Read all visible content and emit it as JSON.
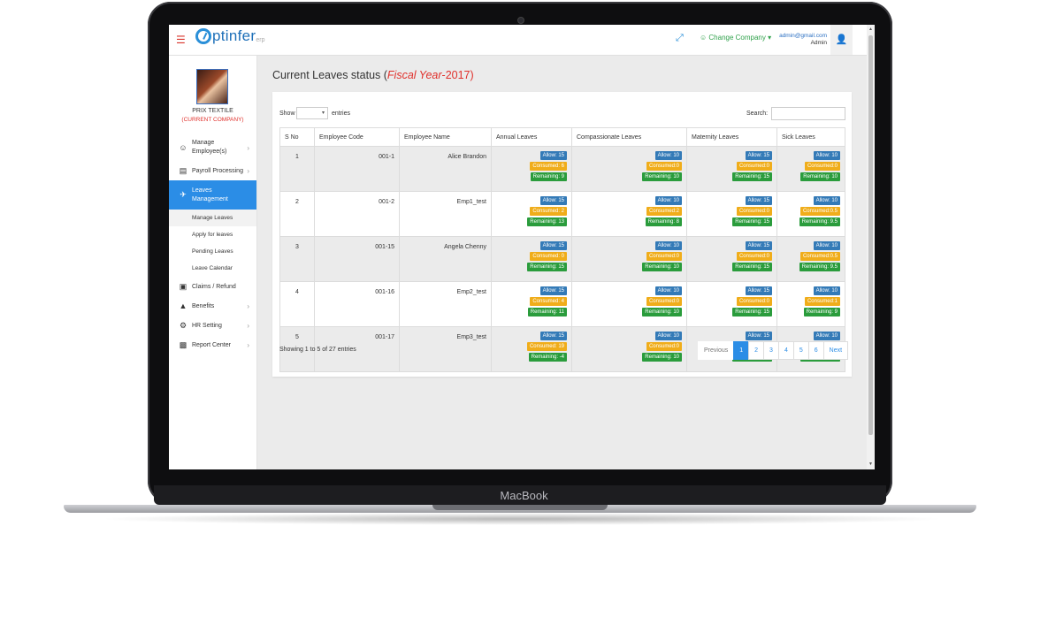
{
  "device": {
    "brand": "MacBook"
  },
  "topbar": {
    "logo_text": "ptinfer",
    "logo_sub": "erp",
    "change_company": "☺ Change Company ▾",
    "user_email": "admin@gmail.com",
    "user_role": "Admin"
  },
  "sidebar": {
    "company_name": "PRIX TEXTILE",
    "company_status": "(CURRENT COMPANY)",
    "items": [
      {
        "label": "Manage Employee(s)",
        "icon": "user-icon"
      },
      {
        "label": "Payroll Processing",
        "icon": "payroll-icon"
      },
      {
        "label": "Leaves Management",
        "icon": "plane-icon"
      },
      {
        "label": "Claims / Refund",
        "icon": "money-icon"
      },
      {
        "label": "Benefits",
        "icon": "gift-icon"
      },
      {
        "label": "HR Setting",
        "icon": "gear-icon"
      },
      {
        "label": "Report Center",
        "icon": "bar-chart-icon"
      }
    ],
    "leave_subitems": [
      "Manage Leaves",
      "Apply for leaves",
      "Pending Leaves",
      "Leave Calendar"
    ]
  },
  "page": {
    "title_prefix": "Current Leaves status (",
    "title_fiscal": "Fiscal Year",
    "title_year": "-2017)"
  },
  "table_controls": {
    "show_label": "Show",
    "entries_label": "entries",
    "search_label": "Search:"
  },
  "table": {
    "headers": [
      "S No",
      "Employee Code",
      "Employee Name",
      "Annual Leaves",
      "Compassionate Leaves",
      "Maternity Leaves",
      "Sick Leaves"
    ],
    "rows": [
      {
        "sno": "1",
        "code": "001-1",
        "name": "Alice Brandon",
        "annual": [
          "Allow: 15",
          "Consumed: 6",
          "Remaining: 9"
        ],
        "compassionate": [
          "Allow: 10",
          "Consumed:0",
          "Remaining: 10"
        ],
        "maternity": [
          "Allow: 15",
          "Consumed:0",
          "Remaining: 15"
        ],
        "sick": [
          "Allow: 10",
          "Consumed:0",
          "Remaining: 10"
        ]
      },
      {
        "sno": "2",
        "code": "001-2",
        "name": "Emp1_test",
        "annual": [
          "Allow: 15",
          "Consumed: 2",
          "Remaining: 13"
        ],
        "compassionate": [
          "Allow: 10",
          "Consumed:2",
          "Remaining: 8"
        ],
        "maternity": [
          "Allow: 15",
          "Consumed:0",
          "Remaining: 15"
        ],
        "sick": [
          "Allow: 10",
          "Consumed:0.5",
          "Remaining: 9.5"
        ]
      },
      {
        "sno": "3",
        "code": "001-15",
        "name": "Angela Chenny",
        "annual": [
          "Allow: 15",
          "Consumed: 0",
          "Remaining: 15"
        ],
        "compassionate": [
          "Allow: 10",
          "Consumed:0",
          "Remaining: 10"
        ],
        "maternity": [
          "Allow: 15",
          "Consumed:0",
          "Remaining: 15"
        ],
        "sick": [
          "Allow: 10",
          "Consumed:0.5",
          "Remaining: 9.5"
        ]
      },
      {
        "sno": "4",
        "code": "001-16",
        "name": "Emp2_test",
        "annual": [
          "Allow: 15",
          "Consumed: 4",
          "Remaining: 11"
        ],
        "compassionate": [
          "Allow: 10",
          "Consumed:0",
          "Remaining: 10"
        ],
        "maternity": [
          "Allow: 15",
          "Consumed:0",
          "Remaining: 15"
        ],
        "sick": [
          "Allow: 10",
          "Consumed:1",
          "Remaining: 9"
        ]
      },
      {
        "sno": "5",
        "code": "001-17",
        "name": "Emp3_test",
        "annual": [
          "Allow: 15",
          "Consumed: 19",
          "Remaining: -4"
        ],
        "compassionate": [
          "Allow: 10",
          "Consumed:0",
          "Remaining: 10"
        ],
        "maternity": [
          "Allow: 15",
          "Consumed:0",
          "Remaining: 15"
        ],
        "sick": [
          "Allow: 10",
          "Consumed:0",
          "Remaining: 10"
        ]
      }
    ]
  },
  "footer": {
    "showing": "Showing 1 to 5 of 27 entries",
    "pagination": [
      "Previous",
      "1",
      "2",
      "3",
      "4",
      "5",
      "6",
      "Next"
    ],
    "current_page": "1"
  },
  "colors": {
    "allow": "#337ab7",
    "consumed": "#f0ad1a",
    "remaining": "#2a9c3c",
    "accent": "#2b8de6",
    "highlight_red": "#e0302b"
  }
}
